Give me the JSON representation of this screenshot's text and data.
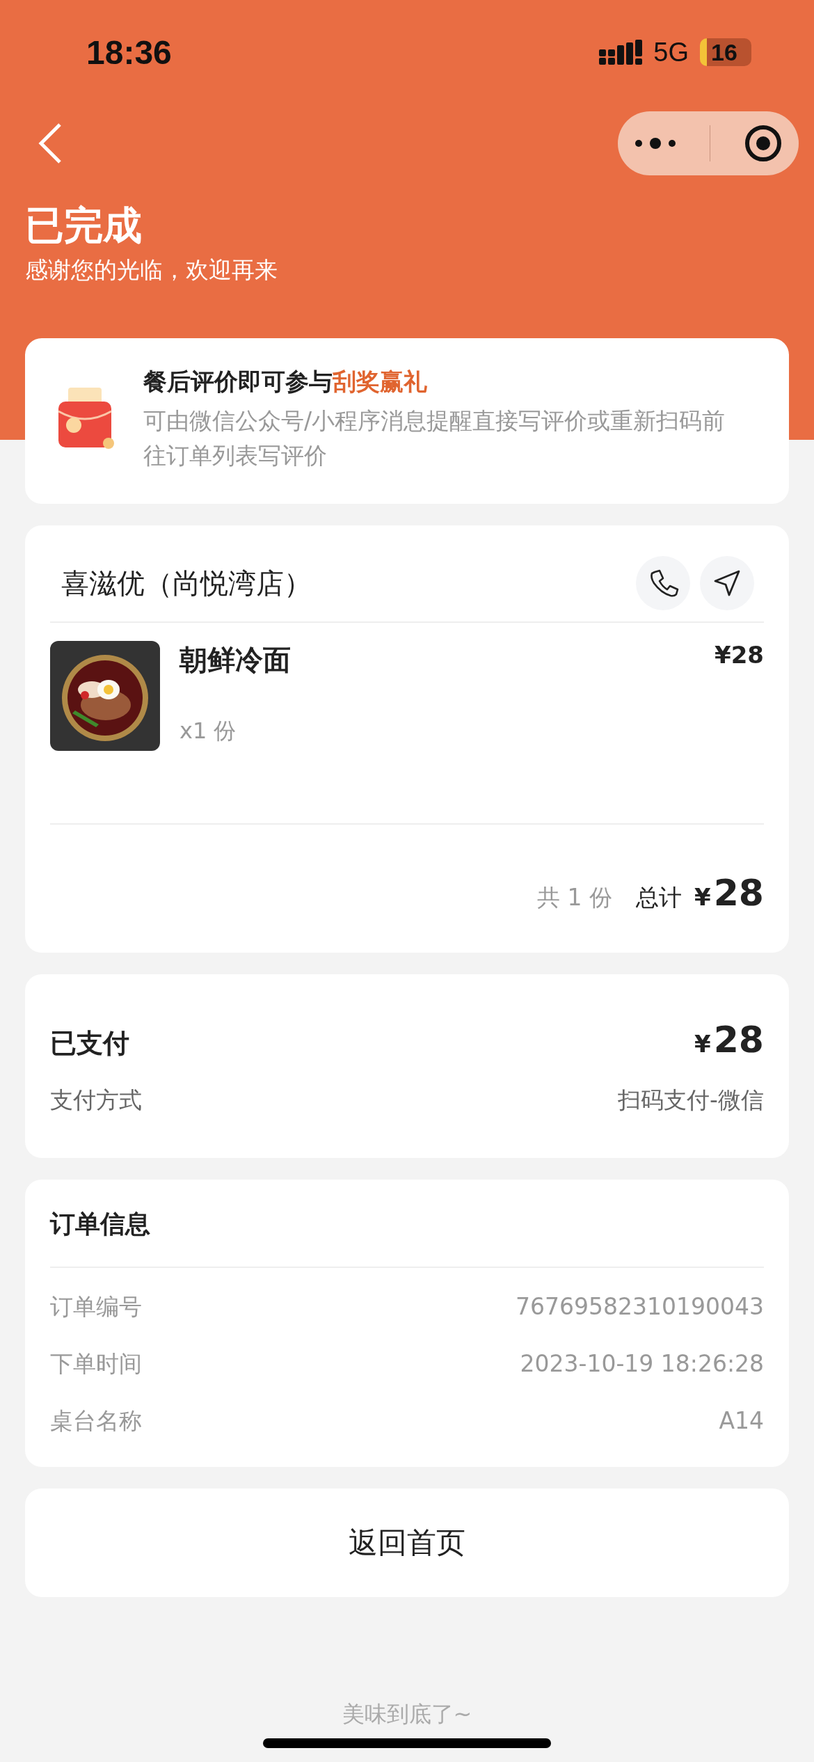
{
  "status_bar": {
    "time": "18:36",
    "network": "5G",
    "battery": "16"
  },
  "header": {
    "title": "已完成",
    "subtitle": "感谢您的光临，欢迎再来"
  },
  "promo": {
    "title": "餐后评价即可参与",
    "highlight": "刮奖赢礼",
    "text": "可由微信公众号/小程序消息提醒直接写评价或重新扫码前往订单列表写评价"
  },
  "order": {
    "store": "喜滋优（尚悦湾店）",
    "items": [
      {
        "kind": "picture",
        "name": "朝鲜冷面",
        "price": "¥28",
        "quantity": "x1 份"
      }
    ],
    "count": "共 1 份",
    "total_label": "总计",
    "currency": "¥",
    "total": "28"
  },
  "payment": {
    "status": "已支付",
    "currency": "¥",
    "amount": "28",
    "method_label": "支付方式",
    "method": "扫码支付-微信"
  },
  "order_info": {
    "title": "订单信息",
    "rows": [
      {
        "label": "订单编号",
        "value": "76769582310190043"
      },
      {
        "label": "下单时间",
        "value": "2023-10-19 18:26:28"
      },
      {
        "label": "桌台名称",
        "value": "A14"
      }
    ]
  },
  "home_button": "返回首页",
  "footer": "美味到底了~"
}
